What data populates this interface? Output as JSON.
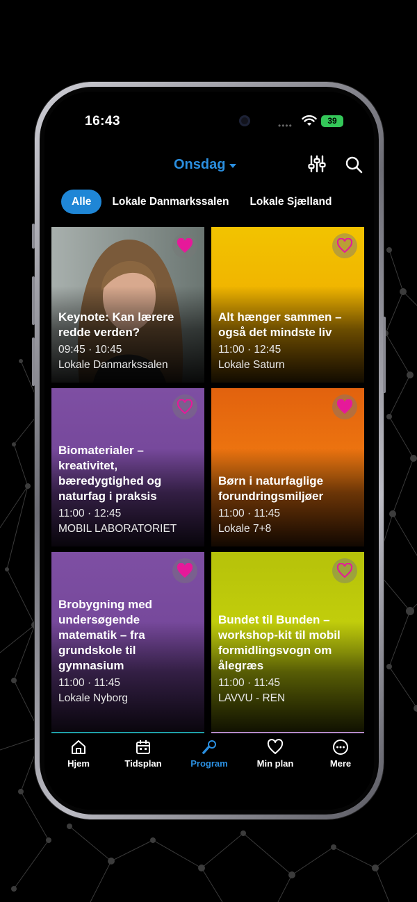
{
  "status_bar": {
    "time": "16:43",
    "battery": "39"
  },
  "header": {
    "day": "Onsdag"
  },
  "room_tabs": [
    "Alle",
    "Lokale Danmarkssalen",
    "Lokale Sjælland"
  ],
  "sessions": [
    {
      "title": "Keynote: Kan lærere redde verden?",
      "time": "09:45 · 10:45",
      "room": "Lokale Danmarkssalen",
      "favorite": true
    },
    {
      "title": "Alt hænger sammen – også det mindste liv",
      "time": "11:00 · 12:45",
      "room": "Lokale Saturn",
      "favorite": false
    },
    {
      "title": "Biomaterialer – kreativitet, bæredygtighed og naturfag i praksis",
      "time": "11:00 · 12:45",
      "room": "MOBIL LABORATORIET",
      "favorite": false
    },
    {
      "title": "Børn i naturfaglige forundringsmiljøer",
      "time": "11:00 · 11:45",
      "room": "Lokale 7+8",
      "favorite": true
    },
    {
      "title": "Brobygning med undersøgende matematik – fra grundskole til gymnasium",
      "time": "11:00 · 11:45",
      "room": "Lokale Nyborg",
      "favorite": true
    },
    {
      "title": "Bundet til Bunden – workshop-kit til mobil formidlingsvogn om ålegræs",
      "time": "11:00 · 11:45",
      "room": "LAVVU - REN",
      "favorite": false
    }
  ],
  "tab_bar": [
    {
      "label": "Hjem",
      "icon": "home-icon"
    },
    {
      "label": "Tidsplan",
      "icon": "calendar-icon"
    },
    {
      "label": "Program",
      "icon": "microphone-icon"
    },
    {
      "label": "Min plan",
      "icon": "heart-icon"
    },
    {
      "label": "Mere",
      "icon": "more-icon"
    }
  ],
  "colors": {
    "accent": "#2b8fe0",
    "favorite": "#e6199a",
    "tab_active_bg": "#1f86d6"
  }
}
